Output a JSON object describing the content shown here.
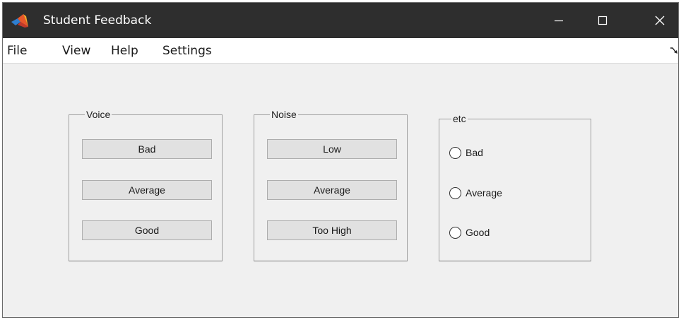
{
  "window": {
    "title": "Student Feedback"
  },
  "menu": {
    "file": "File",
    "view": "View",
    "help": "Help",
    "settings": "Settings"
  },
  "panels": {
    "voice": {
      "title": "Voice",
      "buttons": [
        "Bad",
        "Average",
        "Good"
      ]
    },
    "noise": {
      "title": "Noise",
      "buttons": [
        "Low",
        "Average",
        "Too High"
      ]
    },
    "etc": {
      "title": "etc",
      "radios": [
        "Bad",
        "Average",
        "Good"
      ]
    }
  },
  "icons": {
    "app": "matlab-icon",
    "minimize": "minimize-icon",
    "maximize": "maximize-icon",
    "close": "close-icon",
    "dock": "dock-arrow-icon"
  },
  "colors": {
    "titlebar": "#2e2e2e",
    "background": "#f0f0f0",
    "button": "#e1e1e1"
  }
}
